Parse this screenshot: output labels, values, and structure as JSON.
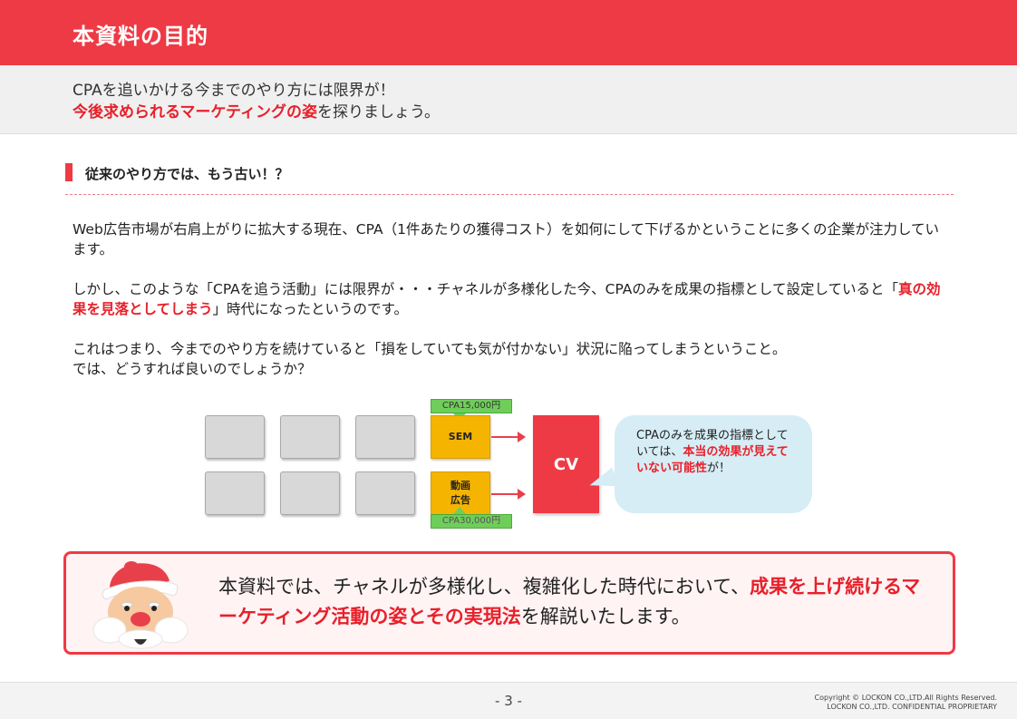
{
  "header": {
    "title": "本資料の目的"
  },
  "subheader": {
    "line1": "CPAを追いかける今までのやり方には限界が！",
    "line2_highlight": "今後求められるマーケティングの姿",
    "line2_rest": "を探りましょう。"
  },
  "section": {
    "heading": "従来のやり方では、もう古い！？"
  },
  "body": {
    "p1": "Web広告市場が右肩上がりに拡大する現在、CPA（1件あたりの獲得コスト）を如何にして下げるかということに多くの企業が注力しています。",
    "p2_pre": "しかし、このような「CPAを追う活動」には限界が・・・チャネルが多様化した今、CPAのみを成果の指標として設定していると「",
    "p2_highlight": "真の効果を見落としてしまう",
    "p2_post": "」時代になったというのです。",
    "p3_line1": "これはつまり、今までのやり方を続けていると「損をしていても気が付かない」状況に陥ってしまうということ。",
    "p3_line2": "では、どうすれば良いのでしょうか？"
  },
  "diagram": {
    "sem_label": "SEM",
    "video_label_1": "動画",
    "video_label_2": "広告",
    "cpa_top": "CPA15,000円",
    "cpa_bottom": "CPA30,000円",
    "cv_label": "CV",
    "bubble_pre": "CPAのみを成果の指標としていては、",
    "bubble_highlight": "本当の効果が見えていない可能性",
    "bubble_post": "が！"
  },
  "callout": {
    "pre": "本資料では、チャネルが多様化し、複雑化した時代において、",
    "highlight": "成果を上げ続けるマーケティング活動の姿とその実現法",
    "post": "を解説いたします。"
  },
  "footer": {
    "page": "- 3 -",
    "copyright": "Copyright © LOCKON CO.,LTD.All Rights Reserved.",
    "confidential": "LOCKON CO.,LTD.  CONFIDENTIAL PROPRIETARY"
  },
  "colors": {
    "accent": "#ee3a45",
    "highlight_text": "#e8202a",
    "orange": "#f5b400",
    "green": "#6fce5a",
    "bubble": "#d6edf5"
  }
}
